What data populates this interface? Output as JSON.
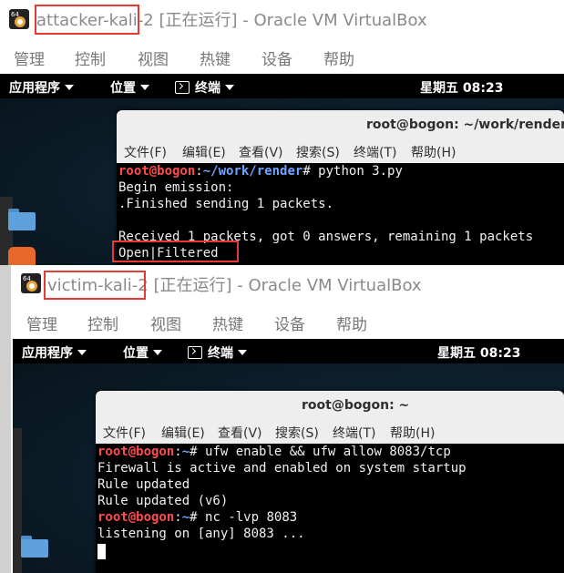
{
  "attacker": {
    "window_title": {
      "vm_name": "attacker-kali-2",
      "rest": " [正在运行] - Oracle VM VirtualBox"
    },
    "menu": [
      "管理",
      "控制",
      "视图",
      "热键",
      "设备",
      "帮助"
    ],
    "panel": {
      "apps": "应用程序",
      "places": "位置",
      "terminal": "终端",
      "clock": "星期五 08:23"
    },
    "terminal": {
      "title": "root@bogon: ~/work/render",
      "menu": [
        "文件(F)",
        "编辑(E)",
        "查看(V)",
        "搜索(S)",
        "终端(T)",
        "帮助(H)"
      ],
      "prompt_user": "root@bogon",
      "prompt_sep": ":",
      "prompt_path": "~/work/render",
      "prompt_hash": "#",
      "command": " python 3.py",
      "output": [
        "Begin emission:",
        ".Finished sending 1 packets.",
        "",
        "Received 1 packets, got 0 answers, remaining 1 packets",
        "Open|Filtered"
      ]
    }
  },
  "victim": {
    "window_title": {
      "vm_name": "victim-kali-2",
      "rest": " [正在运行] - Oracle VM VirtualBox"
    },
    "menu": [
      "管理",
      "控制",
      "视图",
      "热键",
      "设备",
      "帮助"
    ],
    "panel": {
      "apps": "应用程序",
      "places": "位置",
      "terminal": "终端",
      "clock": "星期五 08:23"
    },
    "terminal": {
      "title": "root@bogon: ~",
      "menu": [
        "文件(F)",
        "编辑(E)",
        "查看(V)",
        "搜索(S)",
        "终端(T)",
        "帮助(H)"
      ],
      "prompt_user": "root@bogon",
      "prompt_sep": ":",
      "prompt_path": "~",
      "prompt_hash": "#",
      "command1": " ufw enable && ufw allow 8083/tcp",
      "output1": [
        "Firewall is active and enabled on system startup",
        "Rule updated",
        "Rule updated (v6)"
      ],
      "command2": " nc -lvp 8083",
      "output2": "listening on [any] 8083 ..."
    }
  }
}
